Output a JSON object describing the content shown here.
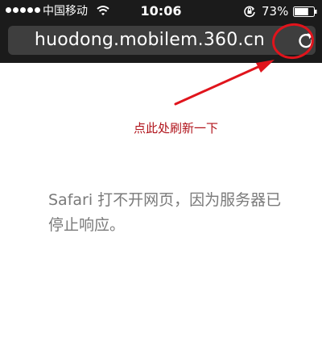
{
  "status_bar": {
    "signal_icon": "signal-strength-icon",
    "carrier": "中国移动",
    "wifi_icon": "wifi-icon",
    "time": "10:06",
    "lock_icon": "orientation-lock-icon",
    "battery_percent": "73%",
    "battery_icon": "battery-icon",
    "battery_level": 0.73
  },
  "address_bar": {
    "url": "huodong.mobilem.360.cn",
    "reload_icon": "reload-icon"
  },
  "annotation": {
    "text": "点此处刷新一下",
    "color": "#b0121a",
    "arrow_color": "#e0141c"
  },
  "error": {
    "message": "Safari 打不开网页，因为服务器已停止响应。"
  }
}
